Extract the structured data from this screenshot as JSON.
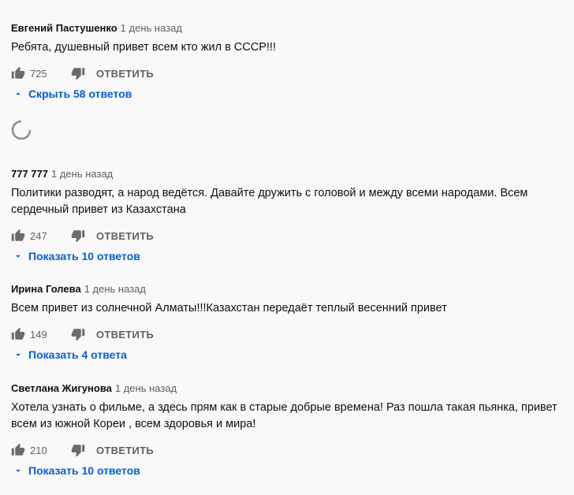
{
  "comments": [
    {
      "author": "Евгений Пастушенко",
      "time": "1 день назад",
      "lines": [
        "Ребята, душевный привет всем кто жил в СССР!!!"
      ],
      "likes": "725",
      "reply_label": "ОТВЕТИТЬ",
      "replies_label": "Скрыть 58 ответов",
      "replies_icon": "chevron-up-icon"
    },
    {
      "author": "777 777",
      "time": "1 день назад",
      "lines": [
        "Политики разводят, а народ ведётся. Давайте дружить с головой и между всеми народами. Всем",
        "сердечный привет из Казахстана"
      ],
      "likes": "247",
      "reply_label": "ОТВЕТИТЬ",
      "replies_label": "Показать 10 ответов",
      "replies_icon": "chevron-down-icon"
    },
    {
      "author": "Ирина Голева",
      "time": "1 день назад",
      "lines": [
        "Всем привет из солнечной Алматы!!!Казахстан передаёт теплый весенний привет"
      ],
      "likes": "149",
      "reply_label": "ОТВЕТИТЬ",
      "replies_label": "Показать 4 ответа",
      "replies_icon": "chevron-down-icon"
    },
    {
      "author": "Светлана Жигунова",
      "time": "1 день назад",
      "lines": [
        "Хотела узнать о фильме, а здесь прям как в старые добрые времена! Раз пошла такая пьянка, привет",
        "всем из южной Кореи , всем здоровья и мира!"
      ],
      "likes": "210",
      "reply_label": "ОТВЕТИТЬ",
      "replies_label": "Показать 10 ответов",
      "replies_icon": "chevron-down-icon"
    }
  ],
  "colors": {
    "link": "#065fd4",
    "muted": "#606060",
    "background": "#f9f9f9"
  }
}
